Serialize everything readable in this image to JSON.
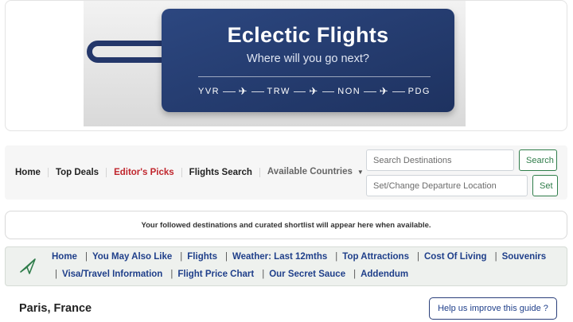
{
  "banner": {
    "title": "Eclectic Flights",
    "subtitle": "Where will you go next?",
    "route": [
      "YVR",
      "TRW",
      "NON",
      "PDG"
    ]
  },
  "navbar": {
    "links": [
      {
        "label": "Home"
      },
      {
        "label": "Top Deals"
      },
      {
        "label": "Editor's Picks"
      },
      {
        "label": "Flights Search"
      },
      {
        "label": "Available Countries"
      }
    ],
    "search": {
      "placeholder": "Search Destinations",
      "button": "Search"
    },
    "departure": {
      "placeholder": "Set/Change Departure Location",
      "button": "Set"
    }
  },
  "notice": "Your followed destinations and curated shortlist will appear here when available.",
  "guide_nav": {
    "row1": [
      "Home",
      "You May Also Like",
      "Flights",
      "Weather: Last 12mths",
      "Top Attractions",
      "Cost Of Living",
      "Souvenirs"
    ],
    "row2": [
      "Visa/Travel Information",
      "Flight Price Chart",
      "Our Secret Sauce",
      "Addendum"
    ]
  },
  "page": {
    "title": "Paris, France",
    "help_button": "Help us improve this guide ?"
  },
  "colors": {
    "brand_navy": "#24376a",
    "link_blue": "#1f3f8a",
    "accent_red": "#c0262d",
    "success_green": "#2f7d4a"
  }
}
